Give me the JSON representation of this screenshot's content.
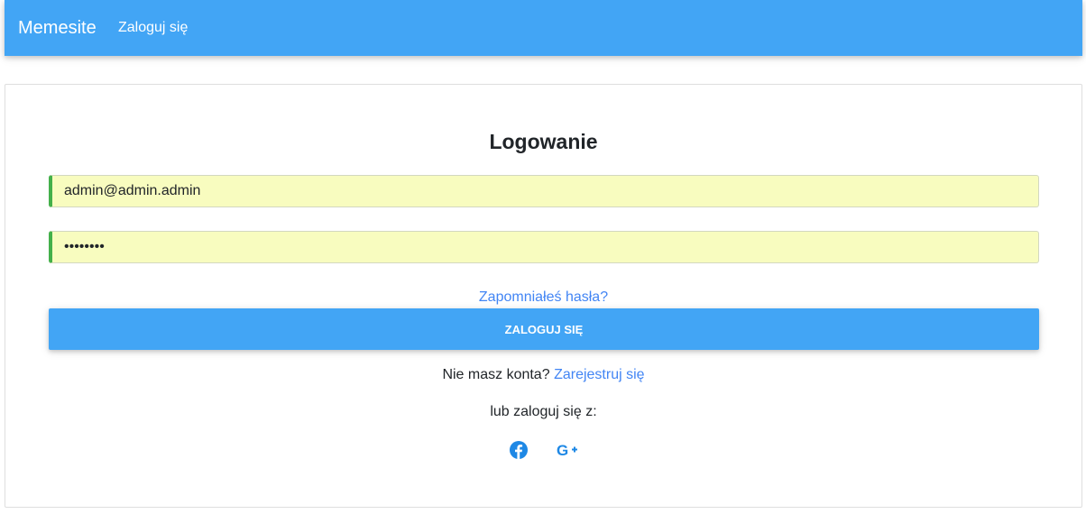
{
  "navbar": {
    "brand": "Memesite",
    "login_link": "Zaloguj się"
  },
  "form": {
    "title": "Logowanie",
    "email_value": "admin@admin.admin",
    "password_value": "password",
    "forgot_link": "Zapomniałeś hasła?",
    "submit_label": "Zaloguj się",
    "no_account_text": "Nie masz konta?",
    "register_link": "Zarejestruj się",
    "alt_login_text": "lub zaloguj się z:"
  },
  "social": [
    {
      "icon": "facebook-icon"
    },
    {
      "icon": "google-plus-icon"
    }
  ],
  "colors": {
    "primary": "#42a5f5",
    "link": "#4285f4",
    "autofill": "#f8fcbf",
    "valid": "#44b04a"
  }
}
